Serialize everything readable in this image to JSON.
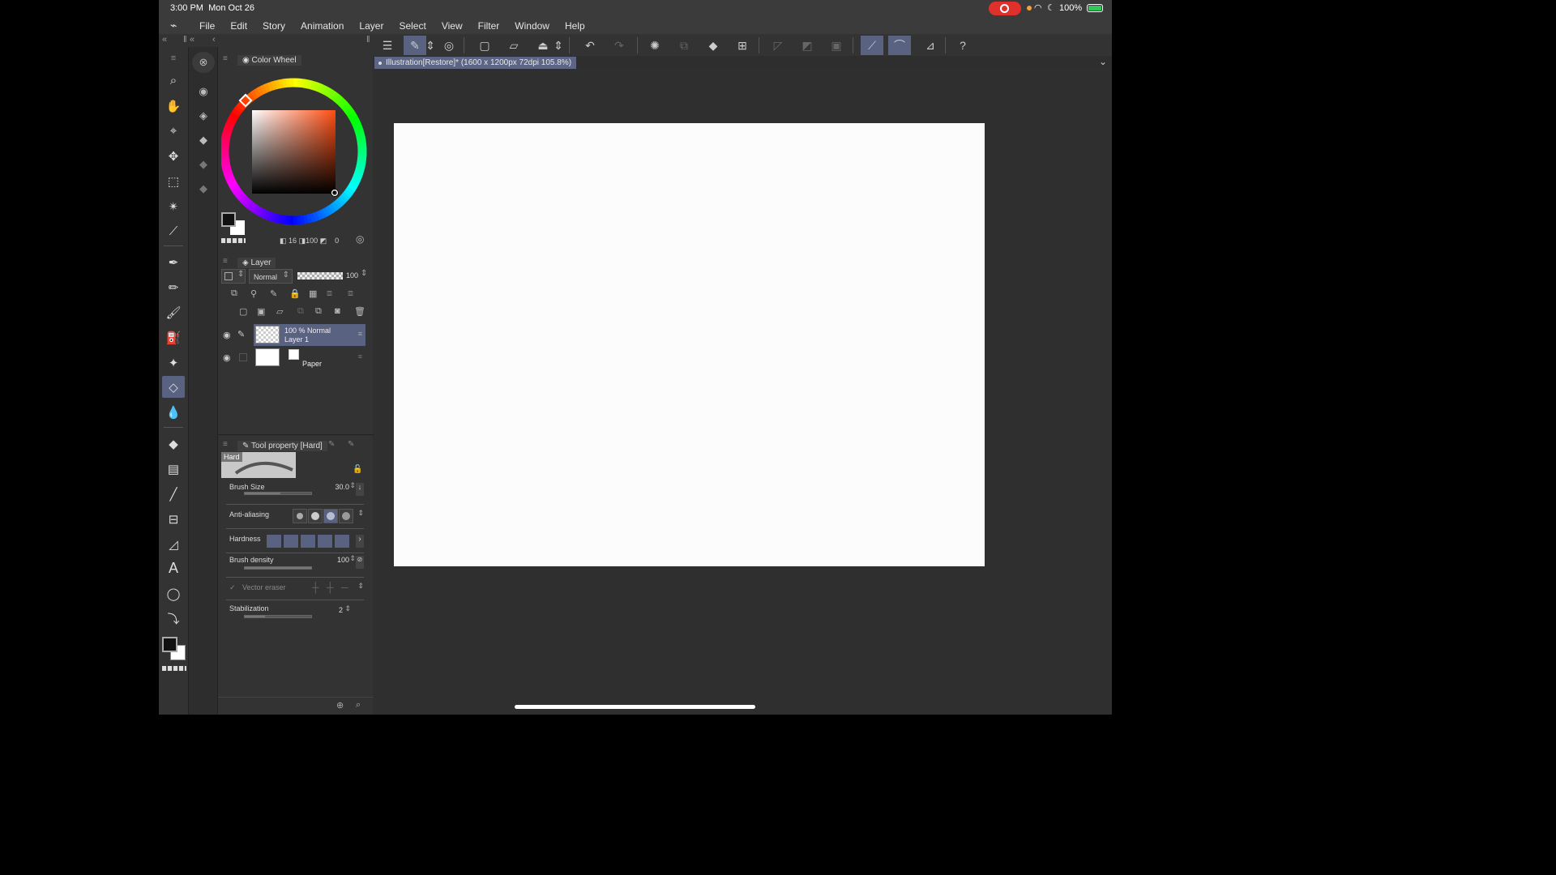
{
  "status_bar": {
    "time": "3:00 PM",
    "date": "Mon Oct 26",
    "battery": "100%"
  },
  "menu": [
    "File",
    "Edit",
    "Story",
    "Animation",
    "Layer",
    "Select",
    "View",
    "Filter",
    "Window",
    "Help"
  ],
  "document_tab": "Illustration[Restore]* (1600 x 1200px 72dpi 105.8%)",
  "color_panel": {
    "title": "Color Wheel",
    "stat_a": "16",
    "stat_b": "100",
    "stat_c": "0"
  },
  "layer_panel": {
    "title": "Layer",
    "blend_mode": "Normal",
    "opacity": "100",
    "layers": [
      {
        "line1": "100 %  Normal",
        "line2": "Layer 1"
      },
      {
        "line1": "",
        "line2": "Paper"
      }
    ]
  },
  "tool_property": {
    "title": "Tool property [Hard]",
    "brush_name": "Hard",
    "brush_size_label": "Brush Size",
    "brush_size": "30.0",
    "antialias_label": "Anti-aliasing",
    "hardness_label": "Hardness",
    "density_label": "Brush density",
    "density": "100",
    "vector_eraser_label": "Vector eraser",
    "stabilization_label": "Stabilization",
    "stabilization": "2"
  },
  "colors": {
    "accent": "#5a6282",
    "record": "#e0302c",
    "battery": "#34c759"
  }
}
